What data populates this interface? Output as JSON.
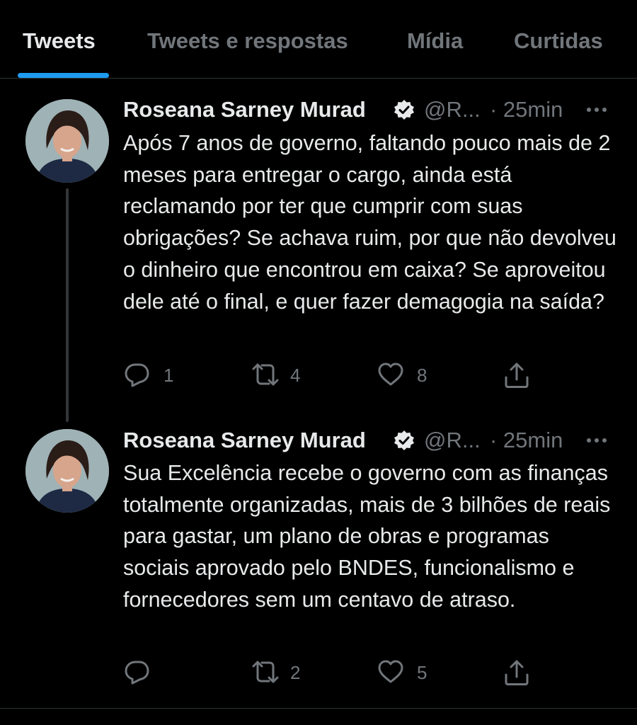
{
  "tabs": [
    {
      "label": "Tweets",
      "active": true
    },
    {
      "label": "Tweets e respostas",
      "active": false
    },
    {
      "label": "Mídia",
      "active": false
    },
    {
      "label": "Curtidas",
      "active": false
    }
  ],
  "colors": {
    "accent": "#1d9bf0",
    "background": "#000000",
    "text_primary": "#e7e9ea",
    "text_secondary": "#71767b"
  },
  "tweets": [
    {
      "author_name": "Roseana Sarney Murad",
      "verified_icon": "verified-badge-icon",
      "handle": "@R...",
      "timestamp": "· 25min",
      "text": "Após 7 anos de governo, faltando pouco mais de 2 meses para entregar o cargo, ainda está reclamando por ter que cumprir com suas obrigações? Se achava ruim, por que não devolveu o dinheiro que encontrou em caixa? Se aproveitou dele até o final, e quer fazer demagogia na saída?",
      "reply_count": "1",
      "retweet_count": "4",
      "like_count": "8"
    },
    {
      "author_name": "Roseana Sarney Murad",
      "verified_icon": "verified-badge-icon",
      "handle": "@R...",
      "timestamp": "· 25min",
      "text": "Sua Excelência recebe o governo com as finanças totalmente organizadas, mais de 3 bilhões de reais para gastar, um plano de obras e programas sociais aprovado pelo BNDES, funcionalismo e fornecedores sem um centavo de atraso.",
      "reply_count": "",
      "retweet_count": "2",
      "like_count": "5"
    }
  ]
}
